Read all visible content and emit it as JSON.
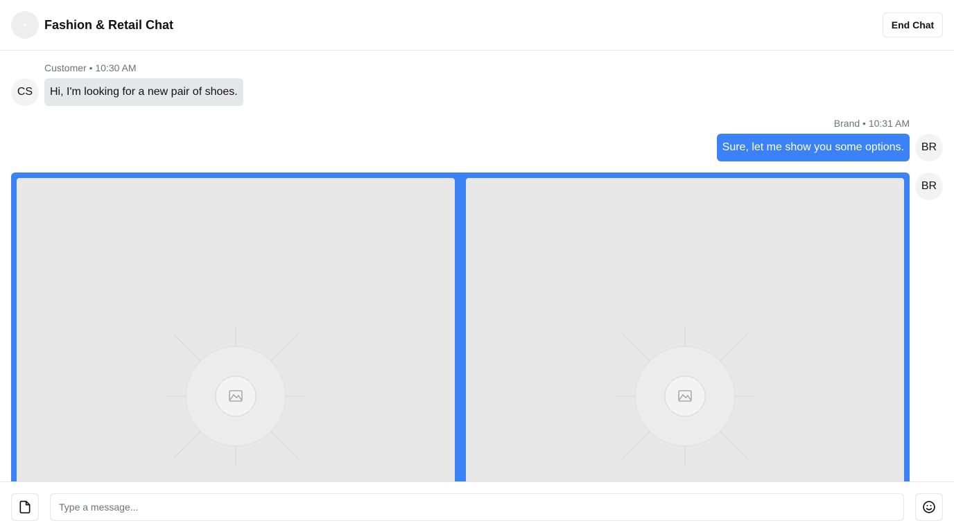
{
  "header": {
    "title": "Fashion & Retail Chat",
    "end_chat_label": "End Chat"
  },
  "messages": [
    {
      "sender": "Customer",
      "time": "10:30 AM",
      "meta": "Customer • 10:30 AM",
      "avatar": "CS",
      "text": "Hi, I'm looking for a new pair of shoes."
    },
    {
      "sender": "Brand",
      "time": "10:31 AM",
      "meta": "Brand • 10:31 AM",
      "avatar": "BR",
      "text": "Sure, let me show you some options."
    }
  ],
  "carousel": {
    "avatar": "BR",
    "items": [
      {
        "image": "image-placeholder-icon"
      },
      {
        "image": "image-placeholder-icon"
      }
    ]
  },
  "composer": {
    "placeholder": "Type a message...",
    "value": "",
    "attach_icon": "file-icon",
    "emoji_icon": "smiley-icon"
  },
  "colors": {
    "accent": "#3b82f6",
    "customer_bubble": "#e5e7eb",
    "border": "#e5e7eb",
    "muted_text": "#6b7280"
  }
}
